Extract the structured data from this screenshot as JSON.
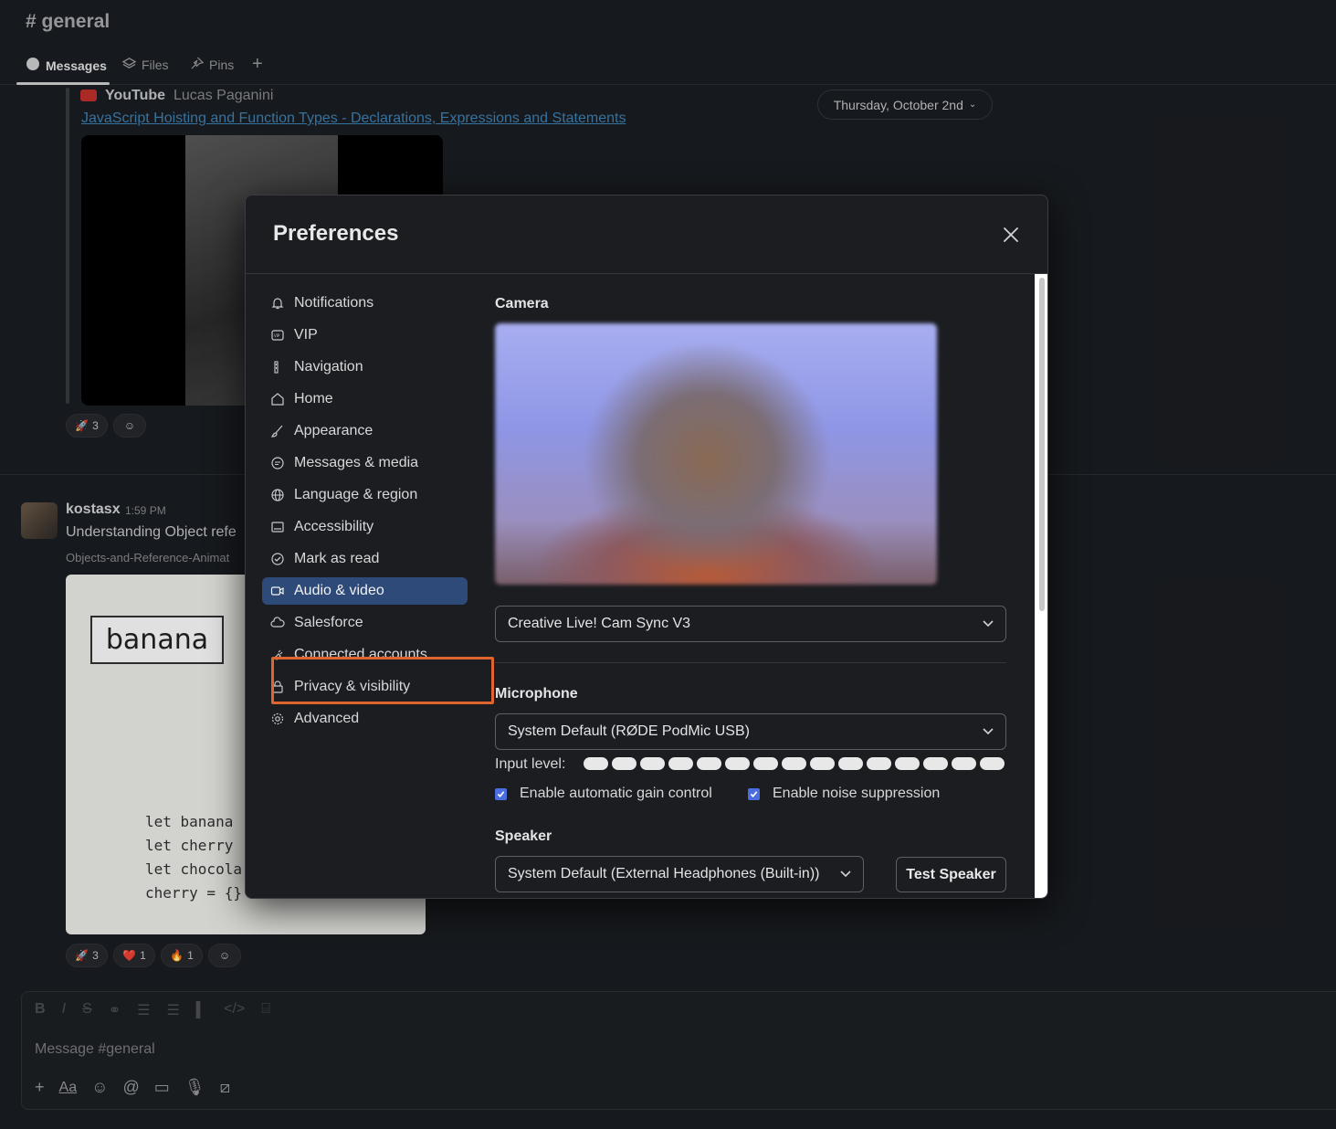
{
  "channel": {
    "title": "# general",
    "tabs": [
      {
        "label": "Messages",
        "icon": "message-bubble-icon",
        "active": true
      },
      {
        "label": "Files",
        "icon": "layers-icon",
        "active": false
      },
      {
        "label": "Pins",
        "icon": "pin-icon",
        "active": false
      }
    ],
    "add_tab_label": "+"
  },
  "background": {
    "youtube_source": "YouTube",
    "youtube_author": "Lucas Paganini",
    "youtube_link": "JavaScript Hoisting and Function Types - Declarations, Expressions and Statements",
    "date_pill": "Thursday, October 2nd",
    "reactions_1": [
      {
        "emoji": "🚀",
        "count": "3"
      }
    ],
    "message_user": "kostasx",
    "message_time": "1:59 PM",
    "message_title": "Understanding Object refe",
    "message_file": "Objects-and-Reference-Animat",
    "image_label": "banana",
    "code_lines": "let banana \nlet cherry \nlet chocola\ncherry = {}",
    "reactions_2": [
      {
        "emoji": "🚀",
        "count": "3"
      },
      {
        "emoji": "❤️",
        "count": "1"
      },
      {
        "emoji": "🔥",
        "count": "1"
      }
    ]
  },
  "composer": {
    "placeholder": "Message #general",
    "format_buttons": [
      "B",
      "I",
      "S",
      "link",
      "ordered-list",
      "bulleted-list",
      "blockquote",
      "code",
      "code-block"
    ],
    "text_format_label": "Aa"
  },
  "preferences": {
    "title": "Preferences",
    "nav_items": [
      {
        "label": "Notifications",
        "icon": "bell-icon",
        "selected": false
      },
      {
        "label": "VIP",
        "icon": "vip-icon",
        "selected": false
      },
      {
        "label": "Navigation",
        "icon": "navigation-icon",
        "selected": false
      },
      {
        "label": "Home",
        "icon": "home-icon",
        "selected": false
      },
      {
        "label": "Appearance",
        "icon": "brush-icon",
        "selected": false
      },
      {
        "label": "Messages & media",
        "icon": "message-icon",
        "selected": false
      },
      {
        "label": "Language & region",
        "icon": "globe-icon",
        "selected": false
      },
      {
        "label": "Accessibility",
        "icon": "keyboard-icon",
        "selected": false
      },
      {
        "label": "Mark as read",
        "icon": "check-circle-icon",
        "selected": false
      },
      {
        "label": "Audio & video",
        "icon": "video-camera-icon",
        "selected": true
      },
      {
        "label": "Salesforce",
        "icon": "cloud-icon",
        "selected": false
      },
      {
        "label": "Connected accounts",
        "icon": "plug-icon",
        "selected": false
      },
      {
        "label": "Privacy & visibility",
        "icon": "lock-icon",
        "selected": false
      },
      {
        "label": "Advanced",
        "icon": "gear-icon",
        "selected": false
      }
    ],
    "camera": {
      "label": "Camera",
      "selected_device": "Creative Live! Cam Sync V3"
    },
    "microphone": {
      "label": "Microphone",
      "selected_device": "System Default (RØDE PodMic USB)",
      "input_level_label": "Input level:",
      "input_level_segments": 15,
      "auto_gain_label": "Enable automatic gain control",
      "auto_gain_checked": true,
      "noise_suppression_label": "Enable noise suppression",
      "noise_suppression_checked": true
    },
    "speaker": {
      "label": "Speaker",
      "selected_device": "System Default (External Headphones (Built-in))",
      "test_button_label": "Test Speaker"
    }
  },
  "colors": {
    "highlight_outline": "#e0642e",
    "selected_nav_bg": "#2e4a78",
    "checkbox": "#4a6de0"
  }
}
